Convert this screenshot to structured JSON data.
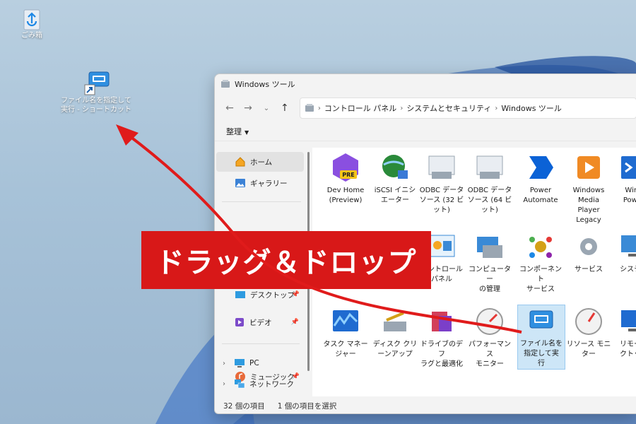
{
  "desktop": {
    "recycle_bin": "ごみ箱",
    "shortcut_line1": "ファイル名を指定して",
    "shortcut_line2": "実行 - ショートカット"
  },
  "window": {
    "title": "Windows ツール",
    "breadcrumb": [
      "コントロール パネル",
      "システムとセキュリティ",
      "Windows ツール"
    ],
    "toolbar": {
      "organize": "整理"
    }
  },
  "sidebar": {
    "items": [
      {
        "label": "ホーム"
      },
      {
        "label": "ギャラリー"
      },
      {
        "label": "デスクトップ"
      },
      {
        "label": "ミュージック"
      },
      {
        "label": "ビデオ"
      },
      {
        "label": "PC"
      },
      {
        "label": "ネットワーク"
      }
    ]
  },
  "tiles": [
    {
      "l1": "Dev Home",
      "l2": "(Preview)"
    },
    {
      "l1": "iSCSI イニシ",
      "l2": "エーター"
    },
    {
      "l1": "ODBC データ",
      "l2": "ソース (32 ビ",
      "l3": "ット)"
    },
    {
      "l1": "ODBC データ",
      "l2": "ソース (64 ビ",
      "l3": "ット)"
    },
    {
      "l1": "Power",
      "l2": "Automate"
    },
    {
      "l1": "Windows",
      "l2": "Media",
      "l3": "Player",
      "l4": "Legacy"
    },
    {
      "l1": "Wind",
      "l2": "Power"
    },
    {
      "l1": "コントロール",
      "l2": "パネル"
    },
    {
      "l1": "コンピューター",
      "l2": "の管理"
    },
    {
      "l1": "コンポーネント",
      "l2": "サービス"
    },
    {
      "l1": "サービス"
    },
    {
      "l1": "システム"
    },
    {
      "l1": "タスク マネー",
      "l2": "ジャー"
    },
    {
      "l1": "ディスク クリ",
      "l2": "ーンアップ"
    },
    {
      "l1": "ドライブのデフ",
      "l2": "ラグと最適化"
    },
    {
      "l1": "パフォーマンス",
      "l2": "モニター"
    },
    {
      "l1": "ファイル名を",
      "l2": "指定して実",
      "l3": "行"
    },
    {
      "l1": "リソース モニ",
      "l2": "ター"
    },
    {
      "l1": "リモート",
      "l2": "クトップ"
    }
  ],
  "status": {
    "count": "32 個の項目",
    "selected": "1 個の項目を選択"
  },
  "banner": {
    "text": "ドラッグ＆ドロップ"
  },
  "colors": {
    "accent": "#d81818",
    "selection": "#cde6f7"
  }
}
